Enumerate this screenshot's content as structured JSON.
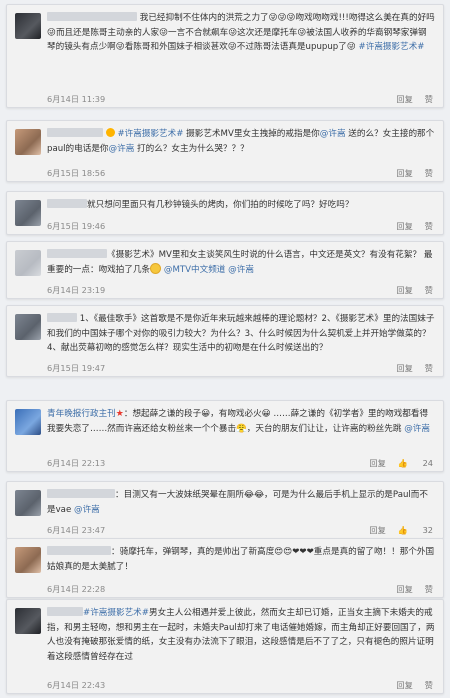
{
  "comments": [
    {
      "text": "我已经抑制不住体内的洪荒之力了😜😜😜吻戏吻吻戏!!!吻得这么美在真的好吗😜而且还是陈哥主动亲的人家😜一言不合就飙车😜这次还是摩托车😜被法国人收养的华裔钢琴家弹钢琴的镜头有点少啊😜看陈哥和外国妹子相谈甚欢😜不过陈哥法语真是upupup了😜",
      "topic": "#许嵩摄影艺术#",
      "time": "6月14日 11:39",
      "reply": "回复",
      "like": "赞"
    },
    {
      "prefix": "#许嵩摄影艺术#",
      "text": " 摄影艺术MV里女主拽掉的戒指是你",
      "mention1": "@许嵩",
      "text2": " 送的么？女主接的那个paul的电话是你",
      "mention2": "@许嵩",
      "text3": " 打的么？女主为什么哭？？？",
      "time": "6月15日 18:56",
      "reply": "回复",
      "like": "赞"
    },
    {
      "text": "就只想问里面只有几秒钟镜头的烤肉，你们拍的时候吃了吗？好吃吗？",
      "time": "6月15日 19:46",
      "reply": "回复",
      "like": "赞"
    },
    {
      "text": "《摄影艺术》MV里和女主谈笑风生时说的什么语言，中文还是英文？有没有花絮？",
      "text2": "最重要的一点：吻戏拍了几条",
      "mention1": "@MTV中文频道",
      "mention2": "@许嵩",
      "time": "6月14日 23:19",
      "reply": "回复",
      "like": "赞"
    },
    {
      "text": "1、《最佳歌手》这首歌是不是你近年来玩越来越棒的理论题材？2、《摄影艺术》里的法国妹子和我们的中国妹子哪个对你的吸引力较大？为什么？3、什么时候因为什么契机爱上并开始学做菜的？4、献出荧幕初吻的感觉怎么样？现实生活中的初吻是在什么时候送出的？",
      "time": "6月15日 19:47",
      "reply": "回复",
      "like": "赞"
    },
    {
      "username": "青年晚报行政主刊",
      "text": "：想起薛之谦的段子😀，有吻戏必火😀 ……薛之谦的《初学者》里的吻戏都看得我要失恋了……然而许嵩还给女粉丝来一个个暴击😤，天台的朋友们让让，让许嵩的粉丝先跳",
      "mention1": "@许嵩",
      "time": "6月14日 22:13",
      "reply": "回复",
      "like": "24"
    },
    {
      "text": "：目测又有一大波妹纸哭晕在厕所😂😂，可是为什么最后手机上显示的是Paul而不是vae",
      "mention1": "@许嵩",
      "time": "6月14日 23:47",
      "reply": "回复",
      "like": "32"
    },
    {
      "text": "：骑摩托车，弹钢琴，真的是帅出了新高度😍😍❤❤❤重点是真的留了吻！！那个外国姑娘真的是太美腻了！",
      "time": "6月14日 22:28",
      "reply": "回复",
      "like": "赞"
    },
    {
      "prefix": "#许嵩摄影艺术#",
      "text": "男女主人公相遇并爱上彼此，然而女主却已订婚，正当女主摘下未婚夫的戒指，和男主轻吻，想和男主在一起时，未婚夫Paul却打来了电话催她婚嫁，而主角却正好要回国了，两人也没有掩破那张爱情的纸，女主没有办法流下了眼泪，这段感情是后不了了之，只有褪色的照片证明着这段感情曾经存在过",
      "time": "6月14日 22:43",
      "reply": "回复",
      "like": "赞"
    }
  ],
  "colors": {
    "link": "#3d6ea8",
    "card_bg": "#f2f2f2",
    "page_bg": "#eef0f3"
  }
}
